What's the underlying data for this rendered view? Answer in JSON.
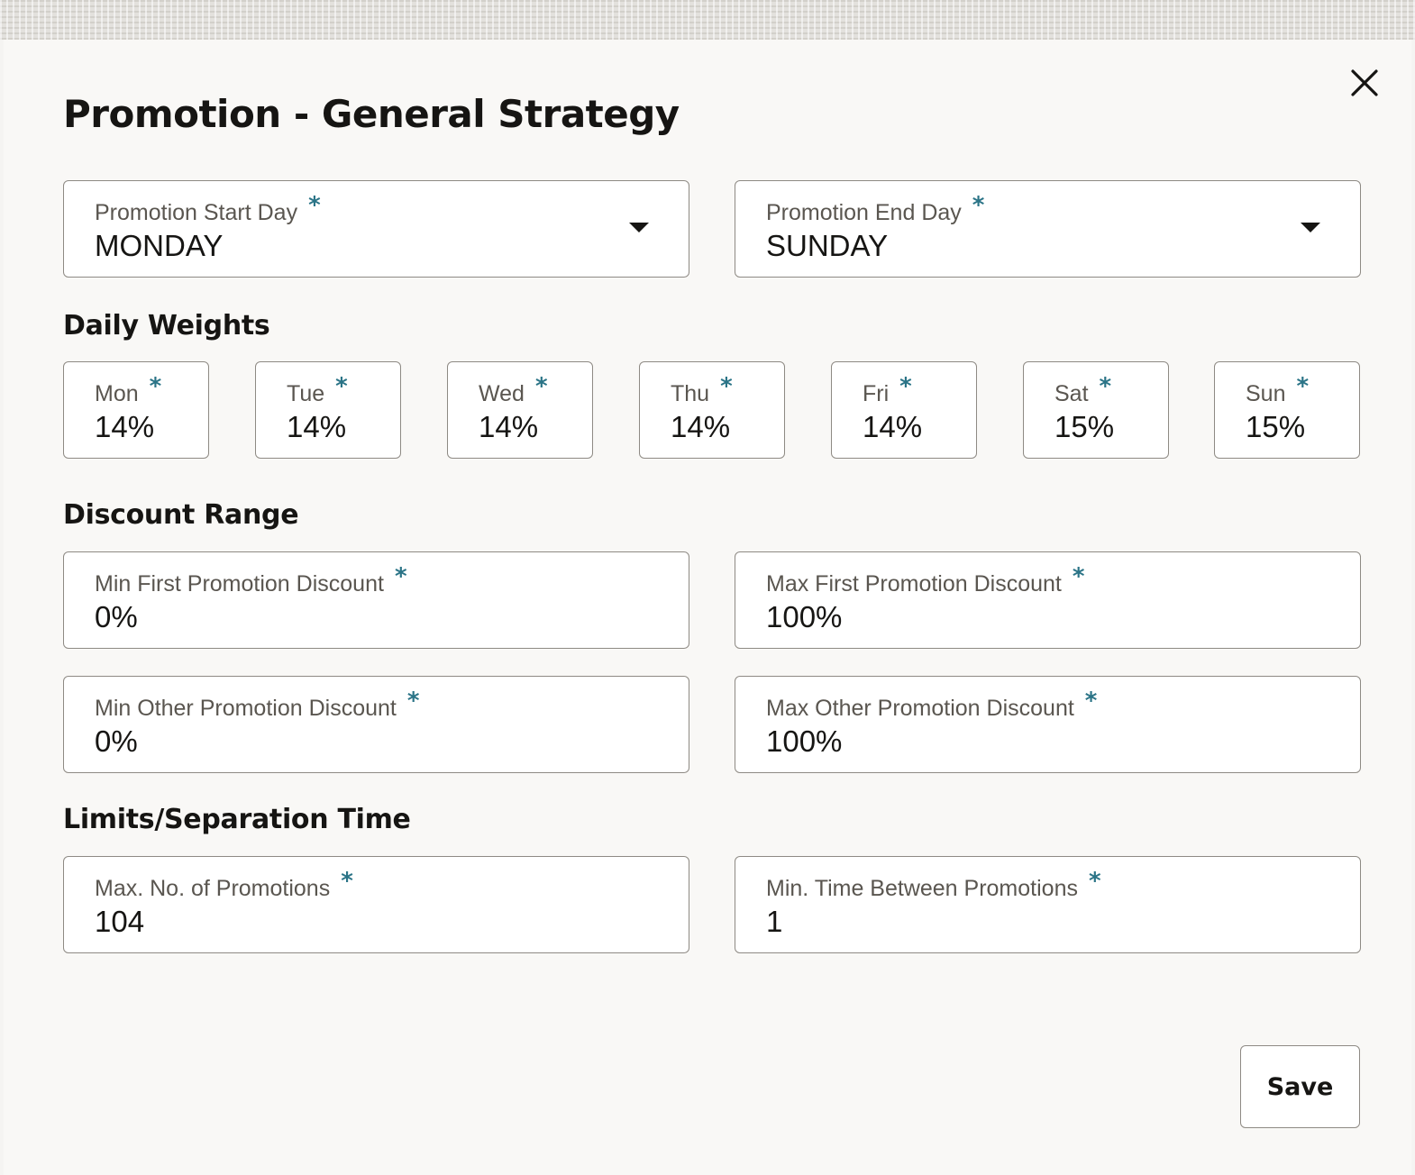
{
  "dialog": {
    "title": "Promotion - General Strategy",
    "close_icon": "close-icon"
  },
  "promotion_days": {
    "start": {
      "label": "Promotion Start Day",
      "required_mark": "*",
      "value": "MONDAY"
    },
    "end": {
      "label": "Promotion End Day",
      "required_mark": "*",
      "value": "SUNDAY"
    }
  },
  "daily_weights": {
    "heading": "Daily Weights",
    "items": [
      {
        "label": "Mon",
        "required_mark": "*",
        "value": "14%"
      },
      {
        "label": "Tue",
        "required_mark": "*",
        "value": "14%"
      },
      {
        "label": "Wed",
        "required_mark": "*",
        "value": "14%"
      },
      {
        "label": "Thu",
        "required_mark": "*",
        "value": "14%"
      },
      {
        "label": "Fri",
        "required_mark": "*",
        "value": "14%"
      },
      {
        "label": "Sat",
        "required_mark": "*",
        "value": "15%"
      },
      {
        "label": "Sun",
        "required_mark": "*",
        "value": "15%"
      }
    ]
  },
  "discount_range": {
    "heading": "Discount Range",
    "min_first": {
      "label": "Min First Promotion Discount",
      "required_mark": "*",
      "value": "0%"
    },
    "max_first": {
      "label": "Max First Promotion Discount",
      "required_mark": "*",
      "value": "100%"
    },
    "min_other": {
      "label": "Min Other Promotion Discount",
      "required_mark": "*",
      "value": "0%"
    },
    "max_other": {
      "label": "Max Other Promotion Discount",
      "required_mark": "*",
      "value": "100%"
    }
  },
  "limits": {
    "heading": "Limits/Separation Time",
    "max_promotions": {
      "label": "Max. No. of Promotions",
      "required_mark": "*",
      "value": "104"
    },
    "min_time_between": {
      "label": "Min. Time Between Promotions",
      "required_mark": "*",
      "value": "1"
    }
  },
  "actions": {
    "save_label": "Save"
  },
  "colors": {
    "required_mark": "#2b7487",
    "field_border": "#8e8a84",
    "text_primary": "#161513",
    "text_label": "#5a5650"
  }
}
